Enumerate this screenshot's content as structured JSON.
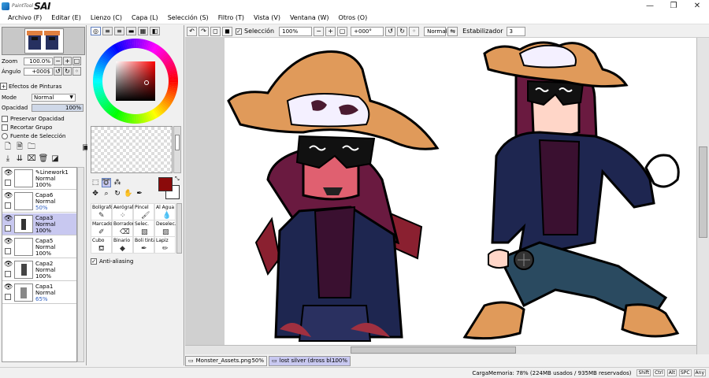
{
  "app": {
    "logo_small": "PaintTool",
    "logo_big": "SAI",
    "window_controls": [
      "—",
      "❐",
      "✕"
    ],
    "accent": "#c8c8f0"
  },
  "menu": [
    {
      "label": "Archivo (F)"
    },
    {
      "label": "Editar (E)"
    },
    {
      "label": "Lienzo (C)"
    },
    {
      "label": "Capa (L)"
    },
    {
      "label": "Selección (S)"
    },
    {
      "label": "Filtro (T)"
    },
    {
      "label": "Vista (V)"
    },
    {
      "label": "Ventana (W)"
    },
    {
      "label": "Otros (O)"
    }
  ],
  "navigator": {
    "zoom_label": "Zoom",
    "zoom_value": "100.0%",
    "angle_label": "Ángulo",
    "angle_value": "+000$"
  },
  "layer_panel": {
    "effects_label": "Efectos de Pinturas",
    "mode_label": "Mode",
    "mode_value": "Normal",
    "opacity_label": "Opacidad",
    "opacity_value": "100%",
    "opacity_fraction": 1.0,
    "preserve_opacity": "Preservar Opacidad",
    "clip_group": "Recortar Grupo",
    "selection_source": "Fuente de Selección",
    "layers": [
      {
        "name": "Linework1",
        "mode": "Normal",
        "opacity": "100%",
        "selected": false,
        "has_pen": true
      },
      {
        "name": "Capa6",
        "mode": "Normal",
        "opacity": "50%",
        "selected": false,
        "has_pen": false
      },
      {
        "name": "Capa3",
        "mode": "Normal",
        "opacity": "100%",
        "selected": true,
        "has_pen": false
      },
      {
        "name": "Capa5",
        "mode": "Normal",
        "opacity": "100%",
        "selected": false,
        "has_pen": false
      },
      {
        "name": "Capa2",
        "mode": "Normal",
        "opacity": "100%",
        "selected": false,
        "has_pen": false
      },
      {
        "name": "Capa1",
        "mode": "Normal",
        "opacity": "65%",
        "selected": false,
        "has_pen": false
      }
    ]
  },
  "color": {
    "foreground": "#8b0a0a",
    "background": "#ffffff"
  },
  "tools": [
    {
      "label": "Bolígrafo",
      "icon": "pen-icon"
    },
    {
      "label": "Aerógrafo",
      "icon": "airbrush-icon"
    },
    {
      "label": "Pincel",
      "icon": "brush-icon"
    },
    {
      "label": "Al Agua",
      "icon": "water-icon"
    },
    {
      "label": "Marcador",
      "icon": "marker-icon"
    },
    {
      "label": "Borrador",
      "icon": "eraser-icon"
    },
    {
      "label": "Selec.",
      "icon": "select-pen-icon"
    },
    {
      "label": "Deselec.",
      "icon": "deselect-pen-icon"
    },
    {
      "label": "Cubo",
      "icon": "bucket-icon"
    },
    {
      "label": "Binario",
      "icon": "binary-icon"
    },
    {
      "label": "Boli tinta",
      "icon": "ink-pen-icon"
    },
    {
      "label": "Lapiz",
      "icon": "pencil-icon"
    }
  ],
  "antialiasing_label": "Anti-aliasing",
  "toolbar": {
    "selection_label": "Selección",
    "zoom": "100%",
    "angle": "+000°",
    "blend_mode": "Normal",
    "stabilizer_label": "Estabilizador",
    "stabilizer_value": "3"
  },
  "docs": [
    {
      "name": "Monster_Assets.png",
      "zoom": "50%",
      "active": false
    },
    {
      "name": "lost silver (dross bl...",
      "zoom": "100%",
      "active": true
    }
  ],
  "status": {
    "memory": "CargaMemoria: 78% (224MB usados / 935MB reservados)",
    "keys": [
      "Shift",
      "Ctrl",
      "Alt",
      "SPC",
      "Any"
    ]
  }
}
